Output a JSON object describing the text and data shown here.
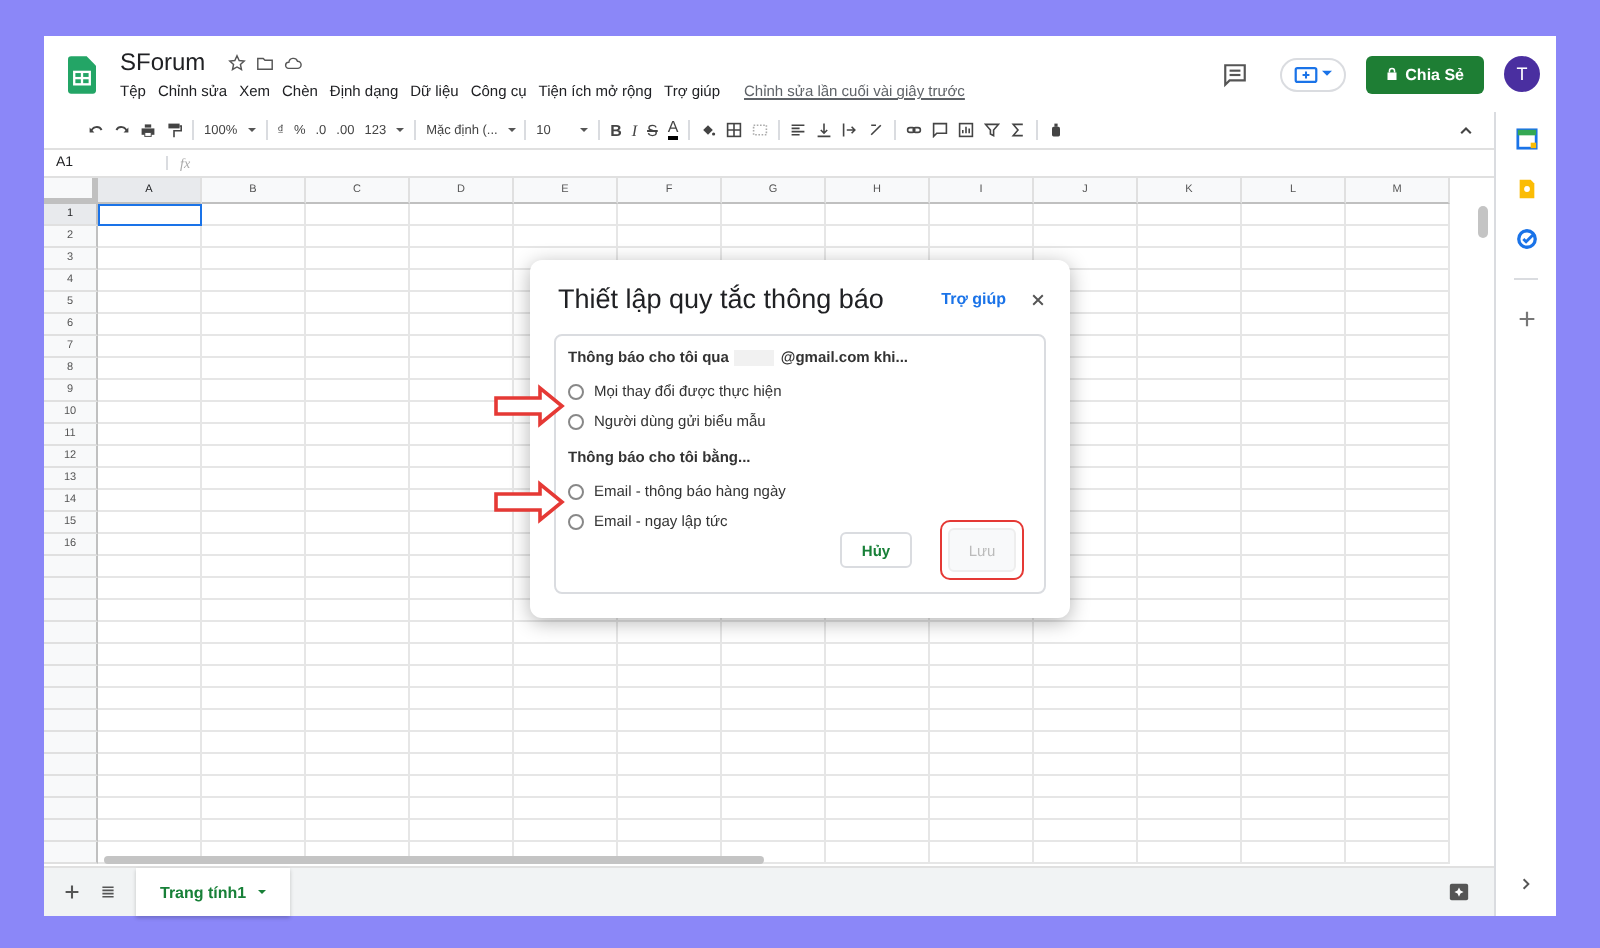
{
  "app": {
    "title": "SForum",
    "menu": [
      "Tệp",
      "Chỉnh sửa",
      "Xem",
      "Chèn",
      "Định dạng",
      "Dữ liệu",
      "Công cụ",
      "Tiện ích mở rộng",
      "Trợ giúp"
    ],
    "last_edit": "Chỉnh sửa lần cuối vài giây trước",
    "share_button": "Chia Sẻ",
    "avatar": "T"
  },
  "toolbar": {
    "zoom": "100%",
    "currency": "₫",
    "percent": "%",
    "decrease_decimals": ".0",
    "increase_decimals": ".00",
    "number_format": "123",
    "font": "Mặc định (...",
    "font_size": "10",
    "bold": "B",
    "italic": "I",
    "strike": "S",
    "text_color": "A"
  },
  "formula_bar": {
    "cell": "A1",
    "fx": "fx"
  },
  "grid": {
    "columns": [
      {
        "label": "A",
        "selected": true
      },
      {
        "label": "B",
        "selected": false
      },
      {
        "label": "C",
        "selected": false
      },
      {
        "label": "D",
        "selected": false
      },
      {
        "label": "E",
        "selected": false
      },
      {
        "label": "F",
        "selected": false
      },
      {
        "label": "G",
        "selected": false
      },
      {
        "label": "H",
        "selected": false
      },
      {
        "label": "I",
        "selected": false
      },
      {
        "label": "J",
        "selected": false
      },
      {
        "label": "K",
        "selected": false
      },
      {
        "label": "L",
        "selected": false
      },
      {
        "label": "M",
        "selected": false
      }
    ],
    "rows": [
      {
        "label": "1",
        "selected": true
      },
      {
        "label": "2",
        "selected": false
      },
      {
        "label": "3",
        "selected": false
      },
      {
        "label": "4",
        "selected": false
      },
      {
        "label": "5",
        "selected": false
      },
      {
        "label": "6",
        "selected": false
      },
      {
        "label": "7",
        "selected": false
      },
      {
        "label": "8",
        "selected": false
      },
      {
        "label": "9",
        "selected": false
      },
      {
        "label": "10",
        "selected": false
      },
      {
        "label": "11",
        "selected": false
      },
      {
        "label": "12",
        "selected": false
      },
      {
        "label": "13",
        "selected": false
      },
      {
        "label": "14",
        "selected": false
      },
      {
        "label": "15",
        "selected": false
      },
      {
        "label": "16",
        "selected": false
      }
    ]
  },
  "sheet_tabs": [
    {
      "label": "Trang tính1",
      "selected": true
    }
  ],
  "dialog": {
    "title": "Thiết lập quy tắc thông báo",
    "help_link": "Trợ giúp",
    "sections": [
      {
        "heading": "Thông báo cho tôi qua",
        "heading_after": "@gmail.com khi...",
        "redacted": true,
        "options": [
          {
            "label": "Mọi thay đổi được thực hiện",
            "selected": false
          },
          {
            "label": "Người dùng gửi biểu mẫu",
            "selected": false
          }
        ]
      },
      {
        "heading": "Thông báo cho tôi bằng...",
        "redacted": false,
        "options": [
          {
            "label": "Email - thông báo hàng ngày",
            "selected": false
          },
          {
            "label": "Email - ngay lập tức",
            "selected": false
          }
        ]
      }
    ],
    "cancel_button": "Hủy",
    "save_button": {
      "label": "Lưu",
      "disabled": true,
      "highlighted": true
    }
  }
}
